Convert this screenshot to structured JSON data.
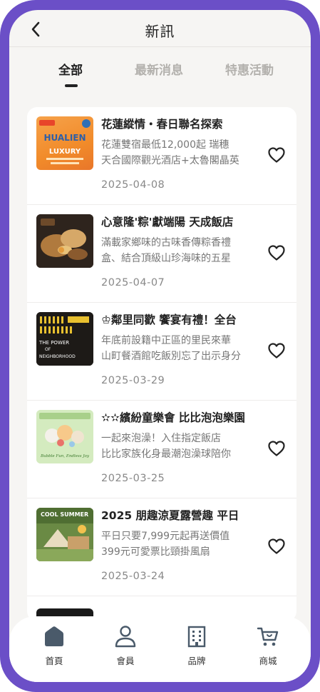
{
  "header": {
    "title": "新訊"
  },
  "tabs": [
    {
      "label": "全部",
      "active": true
    },
    {
      "label": "最新消息",
      "active": false
    },
    {
      "label": "特惠活動",
      "active": false
    }
  ],
  "news": [
    {
      "title": "花蓮縱情・春日聯名探索",
      "desc_line1": "花蓮雙宿最低12,000起 瑞穗",
      "desc_line2": "天合國際觀光酒店+太魯閣晶英",
      "date": "2025-04-08",
      "thumb_text_top": "HUALIEN",
      "thumb_text_bottom": "LUXURY"
    },
    {
      "title": "心意隆'粽'獻端陽 天成飯店",
      "desc_line1": "滿載家鄉味的古味香傳粽香禮",
      "desc_line2": "盒、結合頂級山珍海味的五星",
      "date": "2025-04-07"
    },
    {
      "title": "♔鄰里同歡 饗宴有禮！全台",
      "desc_line1": "年底前設籍中正區的里民來華",
      "desc_line2": "山町餐酒館吃飯別忘了出示身分",
      "date": "2025-03-29",
      "thumb_text_top": "THE POWER",
      "thumb_text_mid": "OF",
      "thumb_text_bottom": "NEIGHBORHOOD"
    },
    {
      "title": "✫✫繽紛童樂會 比比泡泡樂園",
      "desc_line1": "一起來泡澡！入住指定飯店",
      "desc_line2": "比比家族化身最潮泡澡球陪你",
      "date": "2025-03-25",
      "thumb_text_bottom": "Bubble Fun, Endless Joy"
    },
    {
      "title": "2025 朋趣涼夏露營趣 平日",
      "desc_line1": "平日只要7,999元起再送價值",
      "desc_line2": "399元可愛票比頸掛風扇",
      "date": "2025-03-24",
      "thumb_text_top": "COOL SUMMER"
    }
  ],
  "bottom_nav": [
    {
      "label": "首頁",
      "icon": "home-icon"
    },
    {
      "label": "會員",
      "icon": "user-icon"
    },
    {
      "label": "品牌",
      "icon": "building-icon"
    },
    {
      "label": "商城",
      "icon": "cart-icon"
    }
  ],
  "colors": {
    "frame": "#6b4fc7",
    "home_active": "#4a5a6a"
  }
}
